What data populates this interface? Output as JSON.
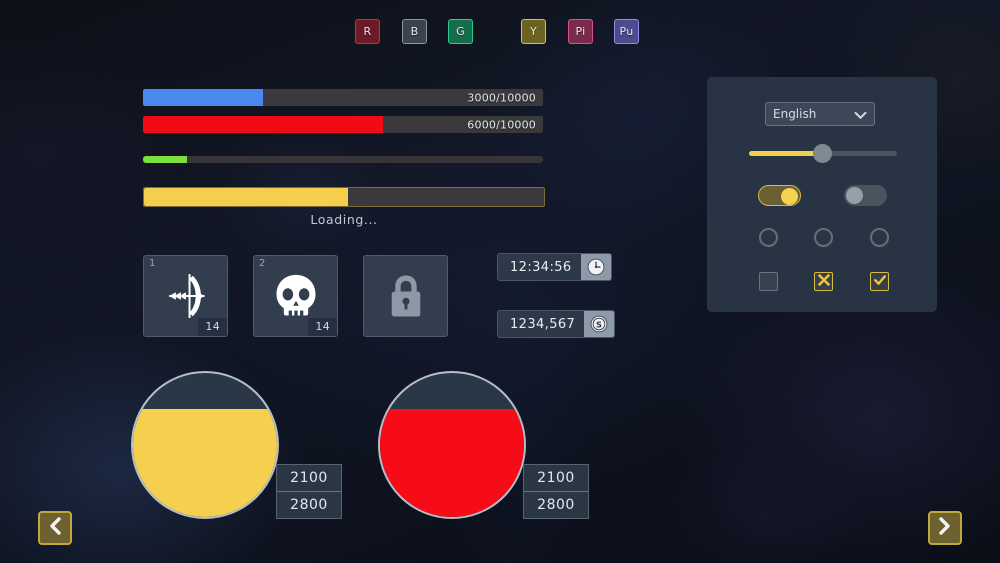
{
  "badges": [
    {
      "label": "R",
      "bg": "#6d1a27",
      "border": "#c1304a"
    },
    {
      "label": "B",
      "bg": "#3c434b",
      "border": "#8b95a0"
    },
    {
      "label": "G",
      "bg": "#176c4e",
      "border": "#2ecb8f"
    },
    {
      "label": "Y",
      "bg": "#6b6420",
      "border": "#d4c43e"
    },
    {
      "label": "Pi",
      "bg": "#7b2a4b",
      "border": "#d8528c"
    },
    {
      "label": "Pu",
      "bg": "#4b4b8f",
      "border": "#8f8fe0"
    }
  ],
  "bars": {
    "blue": {
      "label": "3000/10000",
      "percent": 30,
      "color": "#4a88f0",
      "track": "#3a3a3c"
    },
    "red": {
      "label": "6000/10000",
      "percent": 60,
      "color": "#f00b16",
      "track": "#3a3a3c"
    },
    "green": {
      "label": "",
      "percent": 11,
      "color": "#7ee03c",
      "track": "#35353a"
    },
    "loading": {
      "label": "",
      "percent": 51,
      "color": "#f3cf4d",
      "track": "#3a3a3c"
    },
    "loading_text": "Loading..."
  },
  "slots": [
    {
      "index": "1",
      "count": "14",
      "icon": "bow-and-arrow-icon",
      "locked": false
    },
    {
      "index": "2",
      "count": "14",
      "icon": "skull-icon",
      "locked": false
    },
    {
      "index": "",
      "count": "",
      "icon": "lock-icon",
      "locked": true
    }
  ],
  "chips": [
    {
      "value": "12:34:56",
      "icon": "clock-icon"
    },
    {
      "value": "1234,567",
      "icon": "coin-icon"
    }
  ],
  "gauges": [
    {
      "current": "2100",
      "max": "2800",
      "percent": 75,
      "color": "#f5d04e",
      "empty": "#2a3746"
    },
    {
      "current": "2100",
      "max": "2800",
      "percent": 75,
      "color": "#f80b18",
      "empty": "#2a3746"
    }
  ],
  "nav": {
    "prev_label": "chevron-left-icon",
    "next_label": "chevron-right-icon"
  },
  "settings": {
    "language": {
      "selected": "English",
      "options": [
        "English"
      ]
    },
    "slider": {
      "value": 48
    },
    "toggles": [
      {
        "state": "on"
      },
      {
        "state": "off"
      }
    ],
    "radios": [
      {
        "selected": false
      },
      {
        "selected": false
      },
      {
        "selected": false
      }
    ],
    "checkboxes": [
      {
        "state": "empty"
      },
      {
        "state": "cross"
      },
      {
        "state": "tick"
      }
    ]
  },
  "colors": {
    "accent_yellow": "#f3d14e",
    "accent_red": "#f00b16",
    "accent_blue": "#4a88f0",
    "accent_green": "#7ee03c",
    "panel_bg": "#283443",
    "slot_bg": "#323e4e"
  }
}
